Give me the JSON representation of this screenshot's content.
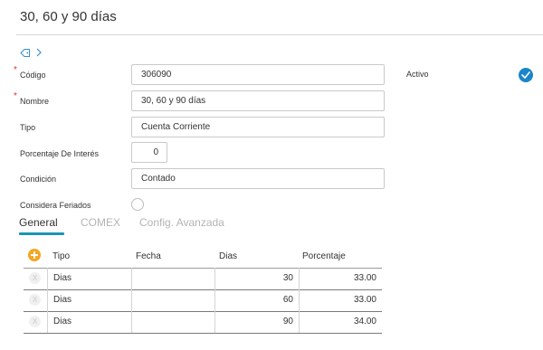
{
  "header": {
    "title": "30, 60 y 90 días"
  },
  "icons": {
    "tag": "tag-icon",
    "chevron": "chevron-right-icon",
    "check": "check-circle-icon",
    "add": "plus-circle-icon",
    "remove": "x-icon"
  },
  "form": {
    "codigo": {
      "label": "Código",
      "value": "306090",
      "required": true
    },
    "nombre": {
      "label": "Nombre",
      "value": "30, 60 y 90 días",
      "required": true
    },
    "tipo": {
      "label": "Tipo",
      "value": "Cuenta Corriente"
    },
    "porcentaje": {
      "label": "Porcentaje De Interés",
      "value": "0"
    },
    "condicion": {
      "label": "Condición",
      "value": "Contado"
    },
    "feriados": {
      "label": "Considera Feriados",
      "checked": false
    },
    "activo": {
      "label": "Activo",
      "checked": true
    },
    "required_mark": "*"
  },
  "tabs": [
    {
      "label": "General",
      "active": true
    },
    {
      "label": "COMEX",
      "active": false
    },
    {
      "label": "Config. Avanzada",
      "active": false
    }
  ],
  "grid": {
    "columns": [
      "Tipo",
      "Fecha",
      "Dias",
      "Porcentaje"
    ],
    "remove_glyph": "X",
    "rows": [
      {
        "tipo": "Dias",
        "fecha": "",
        "dias": "30",
        "porcentaje": "33.00"
      },
      {
        "tipo": "Dias",
        "fecha": "",
        "dias": "60",
        "porcentaje": "33.00"
      },
      {
        "tipo": "Dias",
        "fecha": "",
        "dias": "90",
        "porcentaje": "34.00"
      }
    ]
  },
  "colors": {
    "accent": "#1a95b4",
    "check": "#1a86c8",
    "required": "#d9342b",
    "add": "#f5a623"
  }
}
